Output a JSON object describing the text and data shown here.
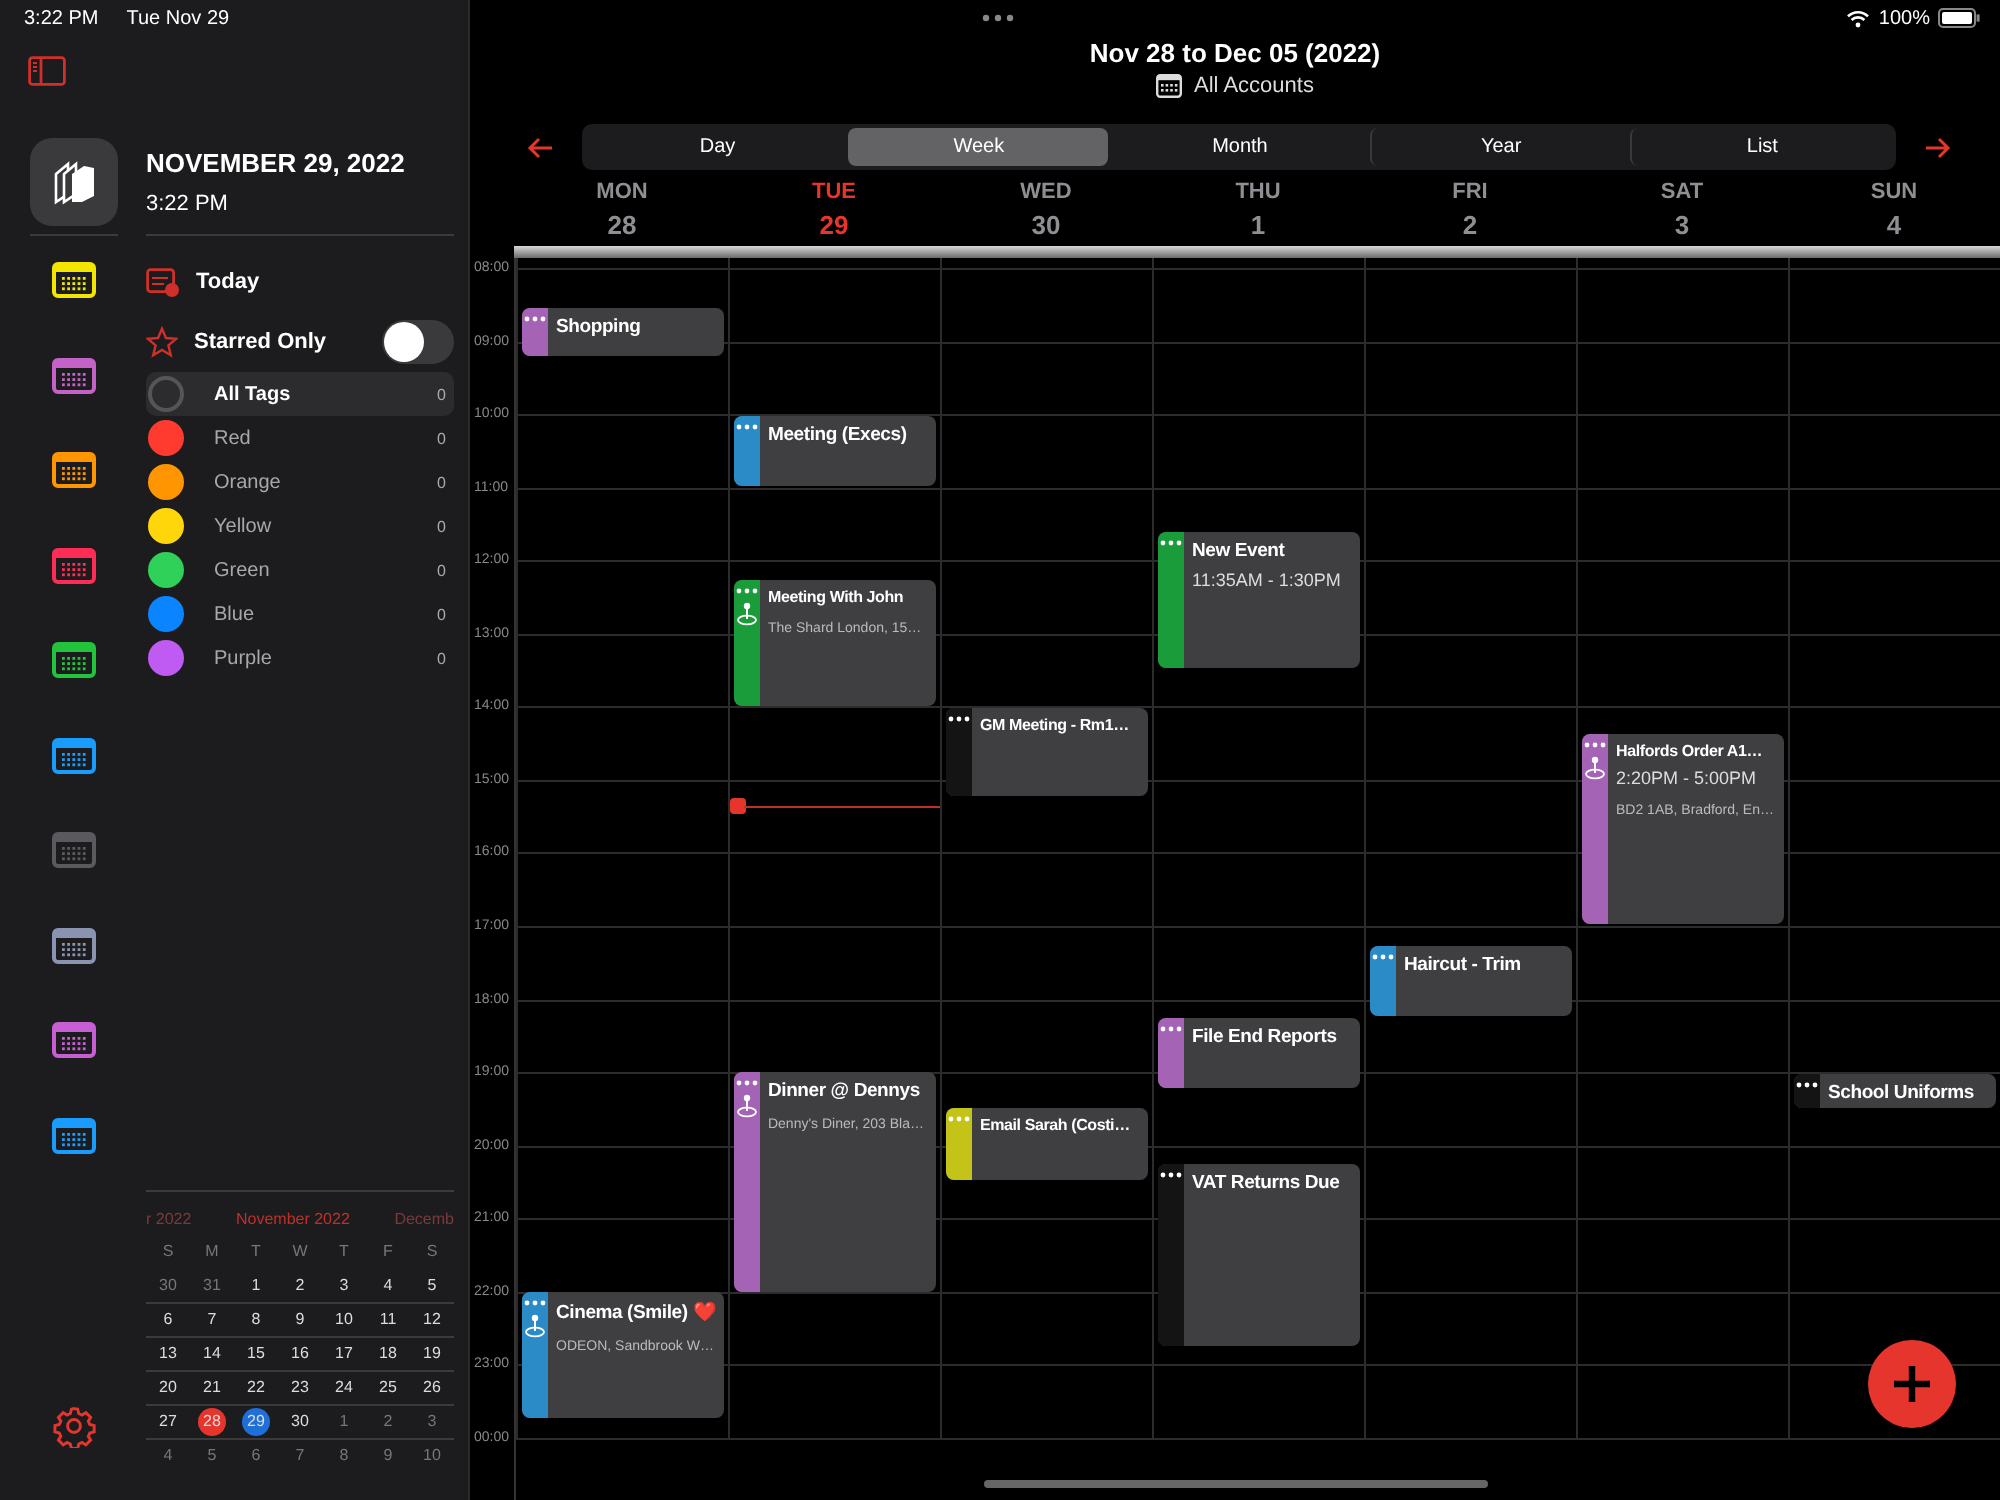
{
  "status_bar": {
    "time": "3:22 PM",
    "date": "Tue Nov 29",
    "battery": "100%"
  },
  "sidebar": {
    "date": "NOVEMBER 29, 2022",
    "time": "3:22 PM",
    "calendars": [
      {
        "color": "#f2e600"
      },
      {
        "color": "#c562c8"
      },
      {
        "color": "#ff9500"
      },
      {
        "color": "#ff2d55"
      },
      {
        "color": "#22c43c"
      },
      {
        "color": "#1a9cff"
      },
      {
        "color": "#5a5a5e"
      },
      {
        "color": "#8a94b0"
      },
      {
        "color": "#c55fd3"
      },
      {
        "color": "#1a9cff"
      }
    ],
    "today_label": "Today",
    "starred": {
      "label": "Starred Only",
      "on": false
    },
    "tags": [
      {
        "kind": "all",
        "label": "All Tags",
        "count": "0",
        "selected": true
      },
      {
        "kind": "color",
        "label": "Red",
        "count": "0",
        "color": "#ff3b30",
        "selected": false
      },
      {
        "kind": "color",
        "label": "Orange",
        "count": "0",
        "color": "#ff9500",
        "selected": false
      },
      {
        "kind": "color",
        "label": "Yellow",
        "count": "0",
        "color": "#ffd60a",
        "selected": false
      },
      {
        "kind": "color",
        "label": "Green",
        "count": "0",
        "color": "#30d158",
        "selected": false
      },
      {
        "kind": "color",
        "label": "Blue",
        "count": "0",
        "color": "#0a84ff",
        "selected": false
      },
      {
        "kind": "color",
        "label": "Purple",
        "count": "0",
        "color": "#bf5af2",
        "selected": false
      }
    ],
    "mini_calendar": {
      "prev": "r 2022",
      "month": "November 2022",
      "next": "Decemb",
      "weekdays": [
        "S",
        "M",
        "T",
        "W",
        "T",
        "F",
        "S"
      ],
      "weeks": [
        [
          {
            "label": "30",
            "in_month": false,
            "selected": false,
            "today": false
          },
          {
            "label": "31",
            "in_month": false,
            "selected": false,
            "today": false
          },
          {
            "label": "1",
            "in_month": true,
            "selected": false,
            "today": false
          },
          {
            "label": "2",
            "in_month": true,
            "selected": false,
            "today": false
          },
          {
            "label": "3",
            "in_month": true,
            "selected": false,
            "today": false
          },
          {
            "label": "4",
            "in_month": true,
            "selected": false,
            "today": false
          },
          {
            "label": "5",
            "in_month": true,
            "selected": false,
            "today": false
          }
        ],
        [
          {
            "label": "6",
            "in_month": true,
            "selected": false,
            "today": false
          },
          {
            "label": "7",
            "in_month": true,
            "selected": false,
            "today": false
          },
          {
            "label": "8",
            "in_month": true,
            "selected": false,
            "today": false
          },
          {
            "label": "9",
            "in_month": true,
            "selected": false,
            "today": false
          },
          {
            "label": "10",
            "in_month": true,
            "selected": false,
            "today": false
          },
          {
            "label": "11",
            "in_month": true,
            "selected": false,
            "today": false
          },
          {
            "label": "12",
            "in_month": true,
            "selected": false,
            "today": false
          }
        ],
        [
          {
            "label": "13",
            "in_month": true,
            "selected": false,
            "today": false
          },
          {
            "label": "14",
            "in_month": true,
            "selected": false,
            "today": false
          },
          {
            "label": "15",
            "in_month": true,
            "selected": false,
            "today": false
          },
          {
            "label": "16",
            "in_month": true,
            "selected": false,
            "today": false
          },
          {
            "label": "17",
            "in_month": true,
            "selected": false,
            "today": false
          },
          {
            "label": "18",
            "in_month": true,
            "selected": false,
            "today": false
          },
          {
            "label": "19",
            "in_month": true,
            "selected": false,
            "today": false
          }
        ],
        [
          {
            "label": "20",
            "in_month": true,
            "selected": false,
            "today": false
          },
          {
            "label": "21",
            "in_month": true,
            "selected": false,
            "today": false
          },
          {
            "label": "22",
            "in_month": true,
            "selected": false,
            "today": false
          },
          {
            "label": "23",
            "in_month": true,
            "selected": false,
            "today": false
          },
          {
            "label": "24",
            "in_month": true,
            "selected": false,
            "today": false
          },
          {
            "label": "25",
            "in_month": true,
            "selected": false,
            "today": false
          },
          {
            "label": "26",
            "in_month": true,
            "selected": false,
            "today": false
          }
        ],
        [
          {
            "label": "27",
            "in_month": true,
            "selected": false,
            "today": false
          },
          {
            "label": "28",
            "in_month": true,
            "selected": true,
            "today": false
          },
          {
            "label": "29",
            "in_month": true,
            "selected": false,
            "today": true
          },
          {
            "label": "30",
            "in_month": true,
            "selected": false,
            "today": false
          },
          {
            "label": "1",
            "in_month": false,
            "selected": false,
            "today": false
          },
          {
            "label": "2",
            "in_month": false,
            "selected": false,
            "today": false
          },
          {
            "label": "3",
            "in_month": false,
            "selected": false,
            "today": false
          }
        ],
        [
          {
            "label": "4",
            "in_month": false,
            "selected": false,
            "today": false
          },
          {
            "label": "5",
            "in_month": false,
            "selected": false,
            "today": false
          },
          {
            "label": "6",
            "in_month": false,
            "selected": false,
            "today": false
          },
          {
            "label": "7",
            "in_month": false,
            "selected": false,
            "today": false
          },
          {
            "label": "8",
            "in_month": false,
            "selected": false,
            "today": false
          },
          {
            "label": "9",
            "in_month": false,
            "selected": false,
            "today": false
          },
          {
            "label": "10",
            "in_month": false,
            "selected": false,
            "today": false
          }
        ]
      ]
    }
  },
  "header": {
    "title": "Nov 28 to Dec 05 (2022)",
    "account": "All Accounts"
  },
  "tabs": [
    {
      "label": "Day",
      "selected": false
    },
    {
      "label": "Week",
      "selected": true
    },
    {
      "label": "Month",
      "selected": false
    },
    {
      "label": "Year",
      "selected": false
    },
    {
      "label": "List",
      "selected": false
    }
  ],
  "days": [
    {
      "name": "MON",
      "date": "28",
      "today": false
    },
    {
      "name": "TUE",
      "date": "29",
      "today": true
    },
    {
      "name": "WED",
      "date": "30",
      "today": false
    },
    {
      "name": "THU",
      "date": "1",
      "today": false
    },
    {
      "name": "FRI",
      "date": "2",
      "today": false
    },
    {
      "name": "SAT",
      "date": "3",
      "today": false
    },
    {
      "name": "SUN",
      "date": "4",
      "today": false
    }
  ],
  "hours": [
    "08:00",
    "09:00",
    "10:00",
    "11:00",
    "12:00",
    "13:00",
    "14:00",
    "15:00",
    "16:00",
    "17:00",
    "18:00",
    "19:00",
    "20:00",
    "21:00",
    "22:00",
    "23:00",
    "00:00"
  ],
  "events": [
    {
      "title": "Shopping",
      "color": "#a463b5",
      "pin": false
    },
    {
      "title": "Meeting (Execs)",
      "color": "#2b8bc6",
      "pin": false
    },
    {
      "title": "New Event",
      "color": "#1a9c3a",
      "pin": false,
      "subtitle": "11:35AM - 1:30PM"
    },
    {
      "title": "Meeting With John",
      "color": "#1a9c3a",
      "pin": true,
      "location": "The Shard London, 15…"
    },
    {
      "title": "GM Meeting - Rm1…",
      "color": "#141414",
      "pin": false
    },
    {
      "title": "Halfords Order A1…",
      "color": "#a463b5",
      "pin": true,
      "subtitle": "2:20PM - 5:00PM",
      "location": "BD2 1AB, Bradford, En…"
    },
    {
      "title": "Haircut - Trim",
      "color": "#2b8bc6",
      "pin": false
    },
    {
      "title": "File End Reports",
      "color": "#a463b5",
      "pin": false
    },
    {
      "title": "Dinner @ Dennys",
      "color": "#a463b5",
      "pin": true,
      "location": "Denny's Diner, 203 Bla…"
    },
    {
      "title": "School Uniforms",
      "color": "#141414",
      "pin": false
    },
    {
      "title": "Email Sarah (Costi…",
      "color": "#c4c418",
      "pin": false
    },
    {
      "title": "VAT Returns Due",
      "color": "#141414",
      "pin": false
    },
    {
      "title": "Cinema (Smile)",
      "emoji": "❤️",
      "color": "#2b8bc6",
      "pin": true,
      "location": "ODEON, Sandbrook W…"
    }
  ]
}
